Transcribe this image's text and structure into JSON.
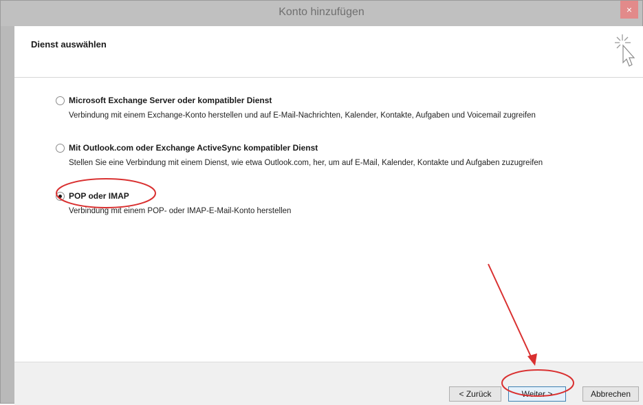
{
  "window": {
    "title": "Konto hinzufügen",
    "close_glyph": "×"
  },
  "header": {
    "title": "Dienst auswählen",
    "icon": "wand-icon"
  },
  "options": [
    {
      "label": "Microsoft Exchange Server oder kompatibler Dienst",
      "description": "Verbindung mit einem Exchange-Konto herstellen und auf E-Mail-Nachrichten, Kalender, Kontakte, Aufgaben und Voicemail zugreifen",
      "selected": false
    },
    {
      "label": "Mit Outlook.com oder Exchange ActiveSync kompatibler Dienst",
      "description": "Stellen Sie eine Verbindung mit einem Dienst, wie etwa Outlook.com, her, um auf E-Mail, Kalender, Kontakte und Aufgaben zuzugreifen",
      "selected": false
    },
    {
      "label": "POP oder IMAP",
      "description": "Verbindung mit einem POP- oder IMAP-E-Mail-Konto herstellen",
      "selected": true
    }
  ],
  "footer": {
    "back_label": "< Zurück",
    "next_label": "Weiter >",
    "cancel_label": "Abbrechen"
  },
  "colors": {
    "annotation": "#d93030",
    "title_bar": "#c0c0c0",
    "close": "#e28a8a"
  }
}
